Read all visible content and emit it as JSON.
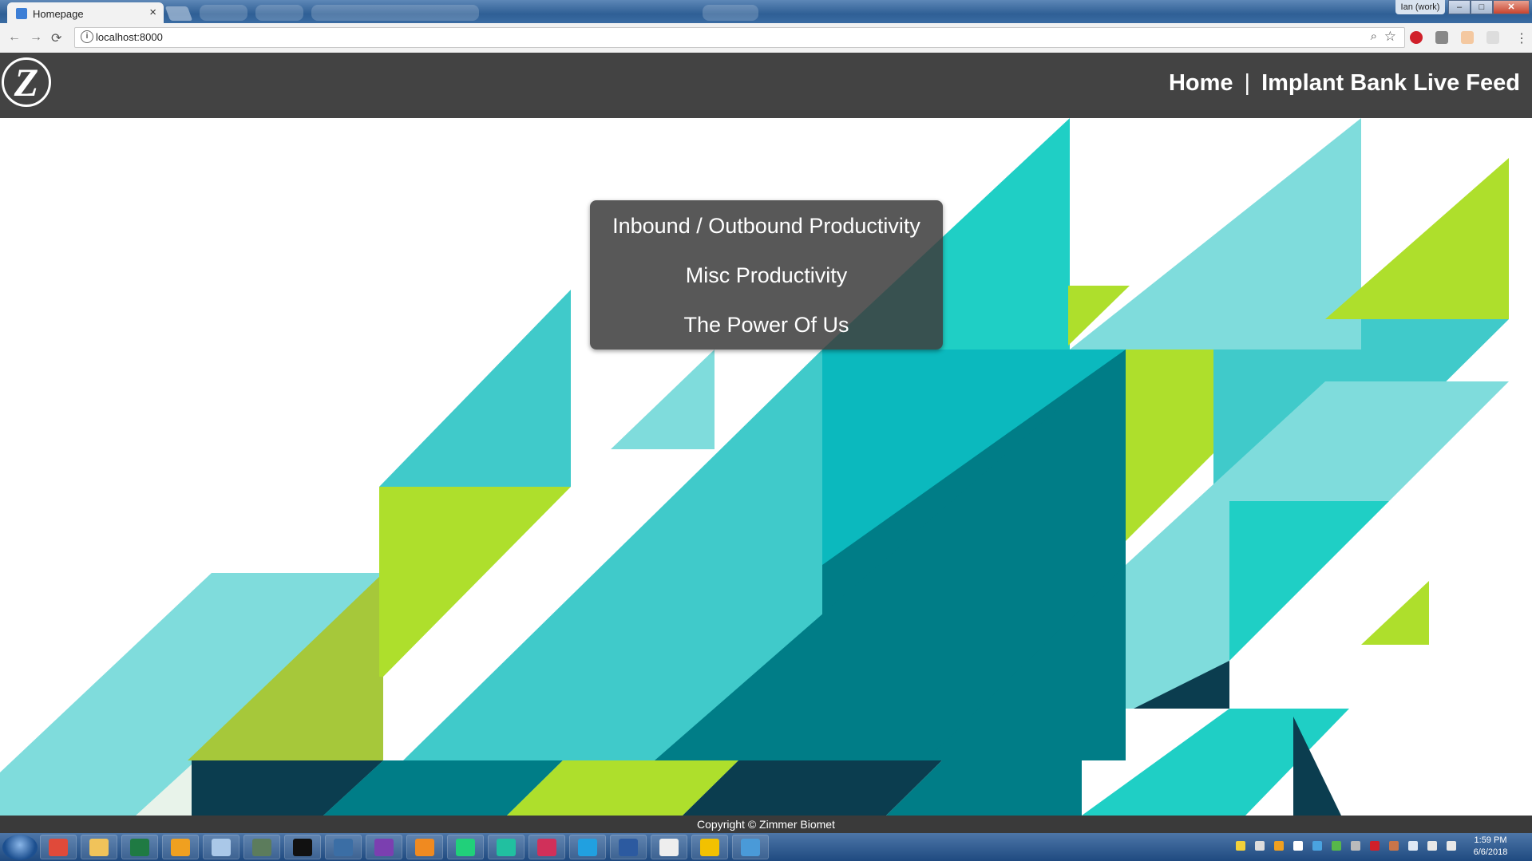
{
  "browser": {
    "tab_title": "Homepage",
    "tab_close": "×",
    "user_label": "Ian (work)",
    "url": "localhost:8000",
    "window_buttons": {
      "minimize": "–",
      "maximize": "□",
      "close": "✕"
    }
  },
  "header": {
    "nav": [
      {
        "label": "Home"
      },
      {
        "label": "Implant Bank Live Feed"
      }
    ],
    "separator": "|"
  },
  "menu": {
    "items": [
      {
        "label": "Inbound / Outbound Productivity"
      },
      {
        "label": "Misc Productivity"
      },
      {
        "label": "The Power Of Us"
      }
    ]
  },
  "footer": {
    "copyright": "Copyright © Zimmer Biomet"
  },
  "taskbar": {
    "time": "1:59 PM",
    "date": "6/6/2018",
    "apps": [
      "chrome-icon",
      "folder-icon",
      "excel-icon",
      "outlook-icon",
      "notepad-icon",
      "monitor-icon",
      "terminal-icon",
      "postgres-icon",
      "visual-studio-icon",
      "sublime-icon",
      "pycharm-icon",
      "datagrip-icon",
      "intellij-icon",
      "webstorm-icon",
      "powershell-icon",
      "barcode-icon",
      "lock-icon",
      "remote-desktop-icon"
    ]
  },
  "colors": {
    "header_bg": "#434343",
    "teal_dark": "#007d87",
    "teal": "#40caca",
    "teal_light": "#7fdcdc",
    "lime": "#aedf2c",
    "navy": "#0b3d4f"
  }
}
